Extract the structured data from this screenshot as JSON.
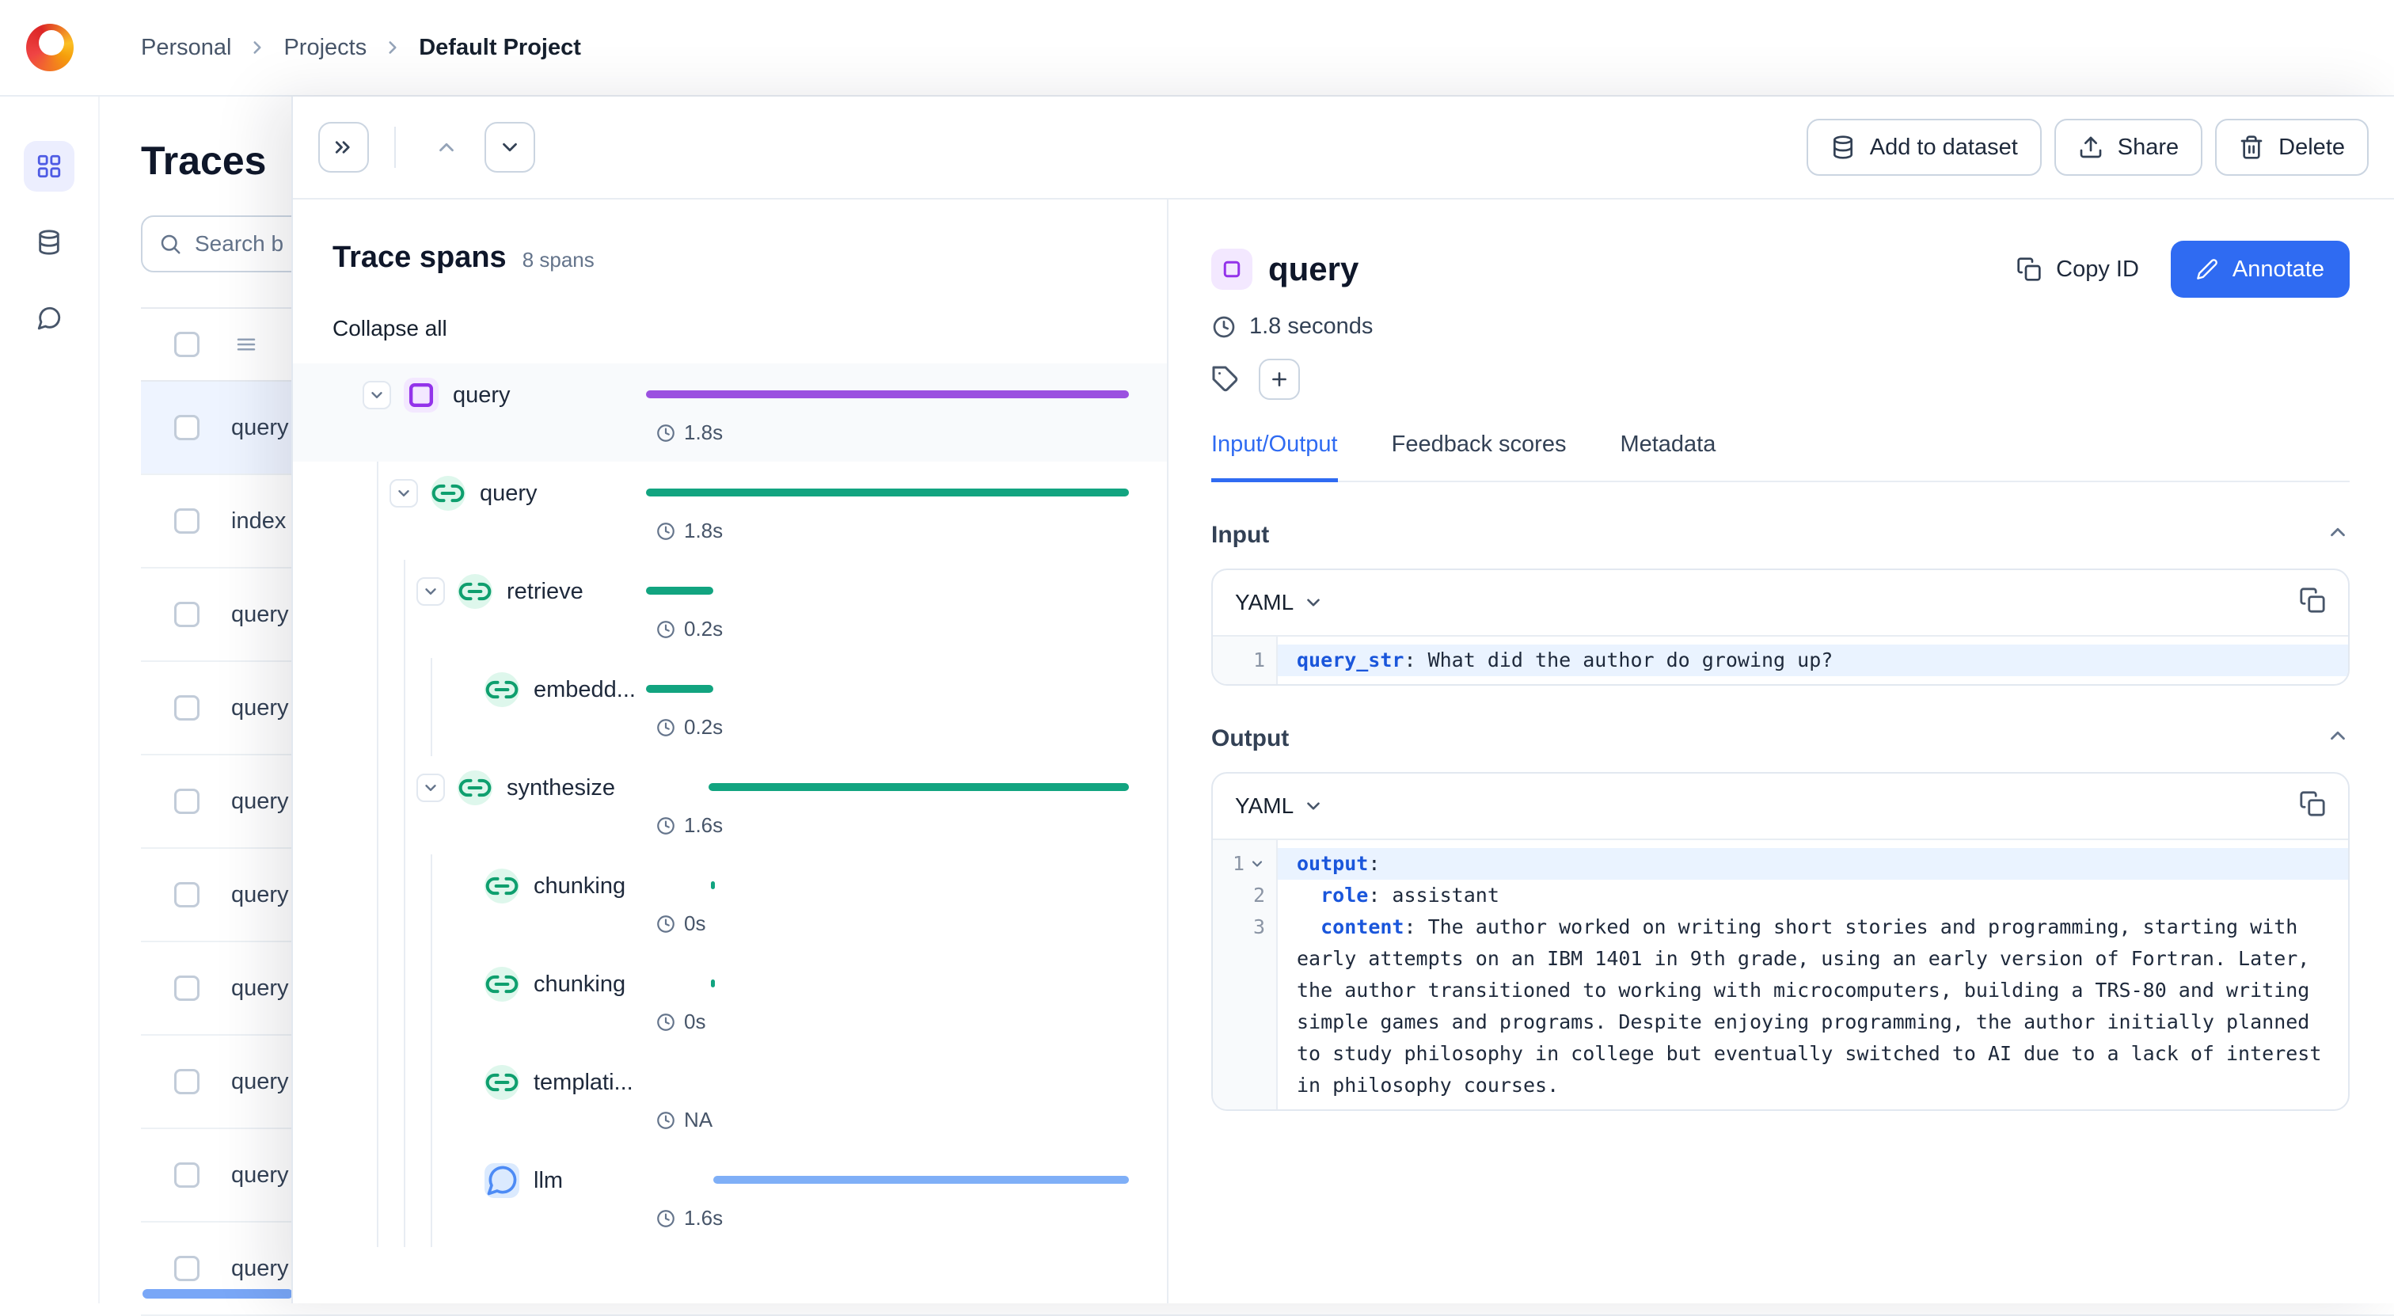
{
  "colors": {
    "accent": "#2F6BF2",
    "purple_bar": "#9B51E0",
    "green_bar": "#12A480",
    "blue_bar": "#7FAFF7"
  },
  "header": {
    "breadcrumb": [
      {
        "label": "Personal"
      },
      {
        "label": "Projects"
      },
      {
        "label": "Default Project",
        "active": true
      }
    ]
  },
  "rail": {
    "items": [
      {
        "name": "projects",
        "icon": "grid",
        "active": true
      },
      {
        "name": "datasets",
        "icon": "database",
        "active": false
      },
      {
        "name": "feedback",
        "icon": "chat",
        "active": false
      }
    ]
  },
  "traces": {
    "title": "Traces",
    "search_placeholder": "Search b",
    "rows": [
      {
        "label": "query",
        "selected": true
      },
      {
        "label": "index",
        "selected": false
      },
      {
        "label": "query",
        "selected": false
      },
      {
        "label": "query",
        "selected": false
      },
      {
        "label": "query",
        "selected": false
      },
      {
        "label": "query",
        "selected": false
      },
      {
        "label": "query",
        "selected": false
      },
      {
        "label": "query",
        "selected": false
      },
      {
        "label": "query",
        "selected": false
      },
      {
        "label": "query",
        "selected": false
      }
    ]
  },
  "toolbar": {
    "add_to_dataset": "Add to dataset",
    "share": "Share",
    "delete": "Delete"
  },
  "spans": {
    "title": "Trace spans",
    "count": "8 spans",
    "collapse_all": "Collapse all",
    "rows": [
      {
        "name": "query",
        "icon": "square",
        "color": "purple",
        "bar_color": "purple_bar",
        "depth": 0,
        "chevron": true,
        "duration": "1.8s",
        "bar": [
          0,
          100
        ],
        "root": true
      },
      {
        "name": "query",
        "icon": "link",
        "color": "green",
        "bar_color": "green_bar",
        "depth": 1,
        "chevron": true,
        "duration": "1.8s",
        "bar": [
          0,
          100
        ]
      },
      {
        "name": "retrieve",
        "icon": "link",
        "color": "green",
        "bar_color": "green_bar",
        "depth": 2,
        "chevron": true,
        "duration": "0.2s",
        "bar": [
          0,
          14
        ]
      },
      {
        "name": "embedd...",
        "icon": "link",
        "color": "green",
        "bar_color": "green_bar",
        "depth": 3,
        "chevron": false,
        "duration": "0.2s",
        "bar": [
          0,
          14
        ]
      },
      {
        "name": "synthesize",
        "icon": "link",
        "color": "green",
        "bar_color": "green_bar",
        "depth": 2,
        "chevron": true,
        "duration": "1.6s",
        "bar": [
          13,
          87
        ]
      },
      {
        "name": "chunking",
        "icon": "link",
        "color": "green",
        "bar_color": "green_bar",
        "depth": 3,
        "chevron": false,
        "duration": "0s",
        "bar": [
          13.5,
          0.8
        ]
      },
      {
        "name": "chunking",
        "icon": "link",
        "color": "green",
        "bar_color": "green_bar",
        "depth": 3,
        "chevron": false,
        "duration": "0s",
        "bar": [
          13.5,
          0.8
        ]
      },
      {
        "name": "templati...",
        "icon": "link",
        "color": "green",
        "bar_color": "green_bar",
        "depth": 3,
        "chevron": false,
        "duration": "NA",
        "bar": null
      },
      {
        "name": "llm",
        "icon": "chat",
        "color": "blue",
        "bar_color": "blue_bar",
        "depth": 3,
        "chevron": false,
        "duration": "1.6s",
        "bar": [
          14,
          86
        ]
      }
    ]
  },
  "detail": {
    "title": "query",
    "duration": "1.8 seconds",
    "copy_id": "Copy ID",
    "annotate": "Annotate",
    "tabs": [
      {
        "label": "Input/Output",
        "active": true
      },
      {
        "label": "Feedback scores",
        "active": false
      },
      {
        "label": "Metadata",
        "active": false
      }
    ],
    "input": {
      "label": "Input",
      "format": "YAML",
      "lines": [
        {
          "num": "1",
          "indent": "",
          "key": "query_str",
          "rest": ": What did the author do growing up?",
          "highlight": true
        }
      ]
    },
    "output": {
      "label": "Output",
      "format": "YAML",
      "lines": [
        {
          "num": "1",
          "fold": true,
          "indent": "",
          "key": "output",
          "rest": ":",
          "highlight": true
        },
        {
          "num": "2",
          "indent": "  ",
          "key": "role",
          "rest": ": assistant",
          "highlight": false
        },
        {
          "num": "3",
          "indent": "  ",
          "key": "content",
          "rest": ": The author worked on writing short stories and programming, starting with early attempts on an IBM 1401 in 9th grade, using an early version of Fortran. Later, the author transitioned to working with microcomputers, building a TRS-80 and writing simple games and programs. Despite enjoying programming, the author initially planned to study philosophy in college but eventually switched to AI due to a lack of interest in philosophy courses.",
          "highlight": false
        }
      ]
    }
  }
}
